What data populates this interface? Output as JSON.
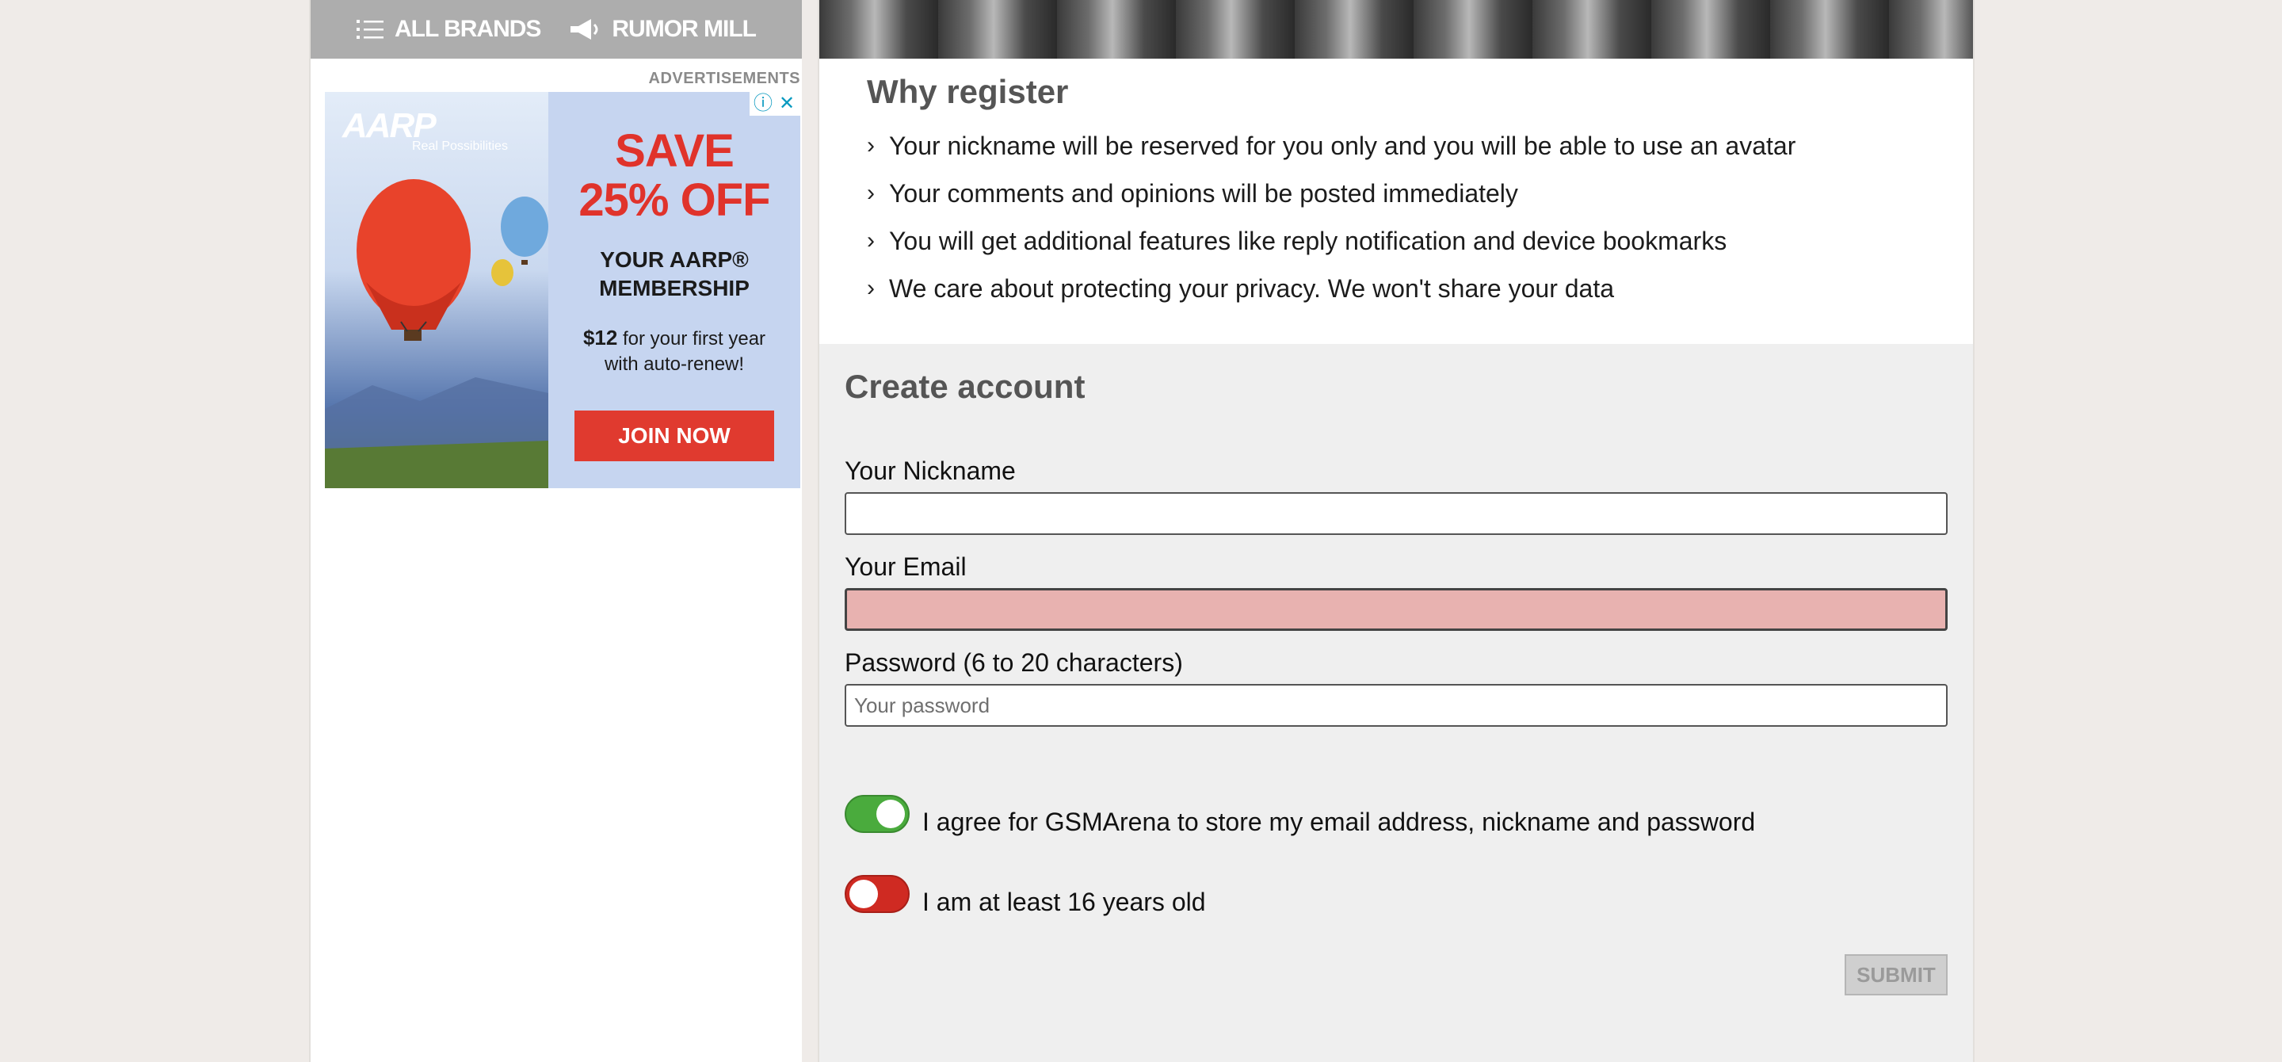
{
  "nav": {
    "all_brands": "ALL BRANDS",
    "rumor_mill": "RUMOR MILL"
  },
  "ads": {
    "label": "ADVERTISEMENTS",
    "brand": "AARP",
    "tagline": "Real Possibilities",
    "headline_line1": "SAVE",
    "headline_line2": "25% OFF",
    "membership_line1": "YOUR AARP®",
    "membership_line2": "MEMBERSHIP",
    "price_bold": "$12",
    "price_rest": " for your first year",
    "price_line2": "with auto-renew!",
    "cta": "JOIN NOW"
  },
  "why": {
    "title": "Why register",
    "items": [
      "Your nickname will be reserved for you only and you will be able to use an avatar",
      "Your comments and opinions will be posted immediately",
      "You will get additional features like reply notification and device bookmarks",
      "We care about protecting your privacy. We won't share your data"
    ]
  },
  "form": {
    "title": "Create account",
    "nickname_label": "Your Nickname",
    "nickname_value": "",
    "email_label": "Your Email",
    "email_value": "",
    "password_label": "Password (6 to 20 characters)",
    "password_placeholder": "Your password",
    "agree_label": "I agree for GSMArena to store my email address, nickname and password",
    "agree_on": true,
    "age_label": "I am at least 16 years old",
    "age_on": false,
    "submit_label": "SUBMIT"
  },
  "colors": {
    "toggle_on": "#4aab3d",
    "toggle_off": "#cf2a22",
    "error_field": "#e8b2b0",
    "ad_red": "#e03a2f"
  }
}
